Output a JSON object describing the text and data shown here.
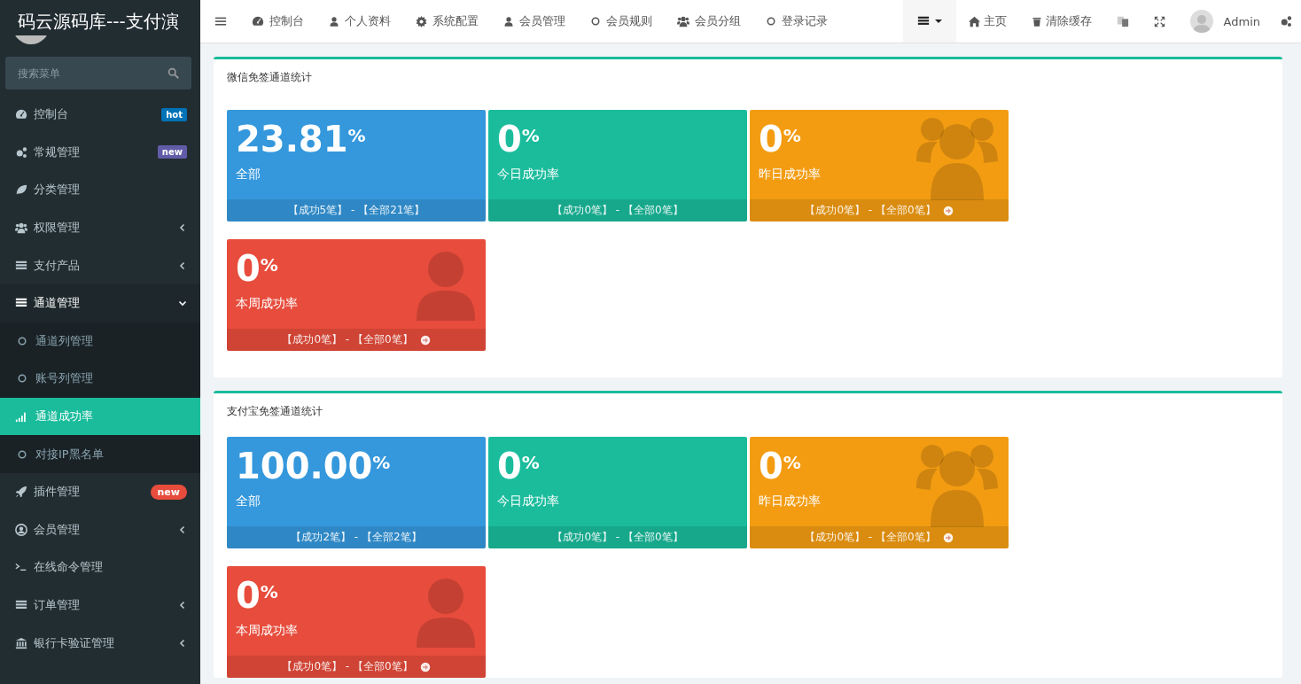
{
  "sidebar": {
    "title": "码云源码库---支付演",
    "search": {
      "placeholder": "搜索菜单"
    },
    "items": [
      {
        "label": "控制台",
        "badge": {
          "text": "hot",
          "kind": "label",
          "color": "#0073b7"
        }
      },
      {
        "label": "常规管理",
        "badge": {
          "text": "new",
          "kind": "label",
          "color": "#605ca8"
        }
      },
      {
        "label": "分类管理"
      },
      {
        "label": "权限管理",
        "expanded": false
      },
      {
        "label": "支付产品",
        "expanded": false
      },
      {
        "label": "通道管理",
        "expanded": true,
        "children": [
          {
            "label": "通道列管理",
            "selected": false
          },
          {
            "label": "账号列管理",
            "selected": false
          },
          {
            "label": "通道成功率",
            "selected": true
          },
          {
            "label": "对接IP黑名单",
            "selected": false
          }
        ]
      },
      {
        "label": "插件管理",
        "badge": {
          "text": "new",
          "kind": "pill",
          "color": "#e74c3c"
        }
      },
      {
        "label": "会员管理",
        "expanded": false
      },
      {
        "label": "在线命令管理"
      },
      {
        "label": "订单管理",
        "expanded": false
      },
      {
        "label": "银行卡验证管理",
        "expanded": false
      }
    ]
  },
  "topbar": {
    "nav": [
      {
        "label": "控制台"
      },
      {
        "label": "个人资料"
      },
      {
        "label": "系统配置"
      },
      {
        "label": "会员管理"
      },
      {
        "label": "会员规则"
      },
      {
        "label": "会员分组"
      },
      {
        "label": "登录记录"
      }
    ],
    "actions": [
      {
        "label": "主页"
      },
      {
        "label": "清除缓存"
      }
    ],
    "user": "Admin"
  },
  "panels": [
    {
      "title": "微信免签通道统计",
      "cards": [
        {
          "value": "23.81",
          "unit": "%",
          "label": "全部",
          "footer": "【成功5笔】 - 【全部21笔】",
          "color": "#3598dc",
          "kind": "plain",
          "arrow": false
        },
        {
          "value": "0",
          "unit": "%",
          "label": "今日成功率",
          "footer": "【成功0笔】 - 【全部0笔】",
          "color": "#1abc9c",
          "kind": "plain",
          "arrow": false
        },
        {
          "value": "0",
          "unit": "%",
          "label": "昨日成功率",
          "footer": "【成功0笔】 - 【全部0笔】",
          "color": "#f39c12",
          "kind": "group",
          "arrow": true
        },
        {
          "value": "0",
          "unit": "%",
          "label": "本周成功率",
          "footer": "【成功0笔】 - 【全部0笔】",
          "color": "#e74c3c",
          "kind": "user",
          "arrow": true
        }
      ]
    },
    {
      "title": "支付宝免签通道统计",
      "cards": [
        {
          "value": "100.00",
          "unit": "%",
          "label": "全部",
          "footer": "【成功2笔】 - 【全部2笔】",
          "color": "#3598dc",
          "kind": "plain",
          "arrow": false
        },
        {
          "value": "0",
          "unit": "%",
          "label": "今日成功率",
          "footer": "【成功0笔】 - 【全部0笔】",
          "color": "#1abc9c",
          "kind": "plain",
          "arrow": false
        },
        {
          "value": "0",
          "unit": "%",
          "label": "昨日成功率",
          "footer": "【成功0笔】 - 【全部0笔】",
          "color": "#f39c12",
          "kind": "group",
          "arrow": true
        },
        {
          "value": "0",
          "unit": "%",
          "label": "本周成功率",
          "footer": "【成功0笔】 - 【全部0笔】",
          "color": "#e74c3c",
          "kind": "user",
          "arrow": true
        }
      ]
    }
  ]
}
